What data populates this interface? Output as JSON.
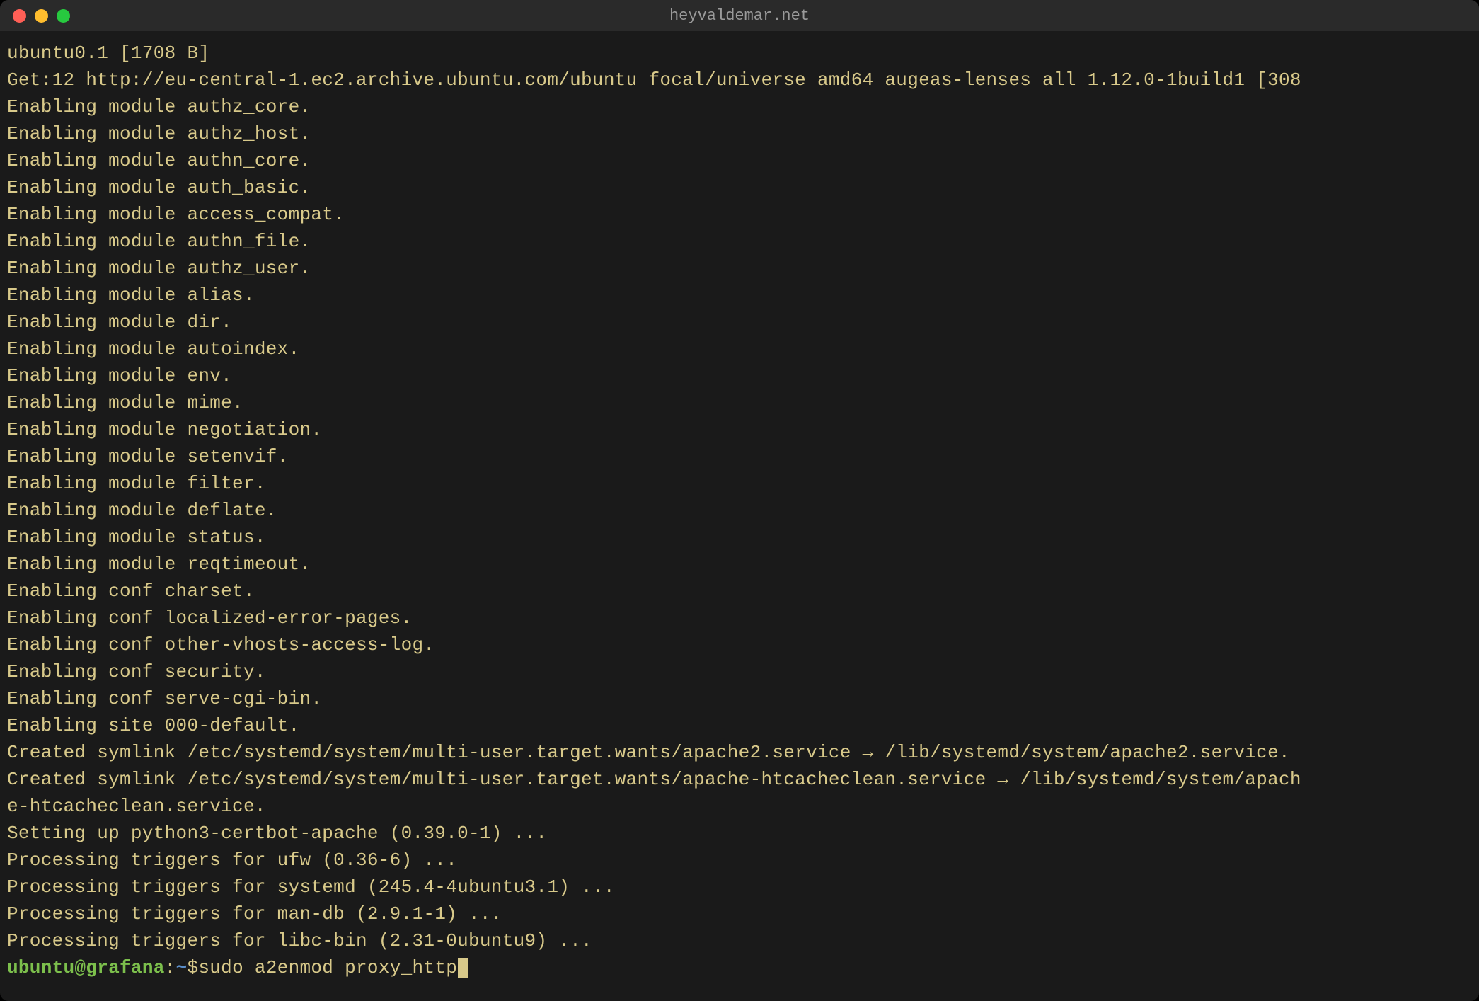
{
  "window": {
    "title": "heyvaldemar.net"
  },
  "terminal": {
    "lines": [
      "ubuntu0.1 [1708 B]",
      "Get:12 http://eu-central-1.ec2.archive.ubuntu.com/ubuntu focal/universe amd64 augeas-lenses all 1.12.0-1build1 [308",
      "Enabling module authz_core.",
      "Enabling module authz_host.",
      "Enabling module authn_core.",
      "Enabling module auth_basic.",
      "Enabling module access_compat.",
      "Enabling module authn_file.",
      "Enabling module authz_user.",
      "Enabling module alias.",
      "Enabling module dir.",
      "Enabling module autoindex.",
      "Enabling module env.",
      "Enabling module mime.",
      "Enabling module negotiation.",
      "Enabling module setenvif.",
      "Enabling module filter.",
      "Enabling module deflate.",
      "Enabling module status.",
      "Enabling module reqtimeout.",
      "Enabling conf charset.",
      "Enabling conf localized-error-pages.",
      "Enabling conf other-vhosts-access-log.",
      "Enabling conf security.",
      "Enabling conf serve-cgi-bin.",
      "Enabling site 000-default.",
      "Created symlink /etc/systemd/system/multi-user.target.wants/apache2.service → /lib/systemd/system/apache2.service.",
      "Created symlink /etc/systemd/system/multi-user.target.wants/apache-htcacheclean.service → /lib/systemd/system/apach",
      "e-htcacheclean.service.",
      "Setting up python3-certbot-apache (0.39.0-1) ...",
      "Processing triggers for ufw (0.36-6) ...",
      "Processing triggers for systemd (245.4-4ubuntu3.1) ...",
      "Processing triggers for man-db (2.9.1-1) ...",
      "Processing triggers for libc-bin (2.31-0ubuntu9) ..."
    ],
    "prompt": {
      "user": "ubuntu",
      "at": "@",
      "host": "grafana",
      "colon": ":",
      "path": "~",
      "dollar": "$ ",
      "command": "sudo a2enmod proxy_http"
    }
  }
}
